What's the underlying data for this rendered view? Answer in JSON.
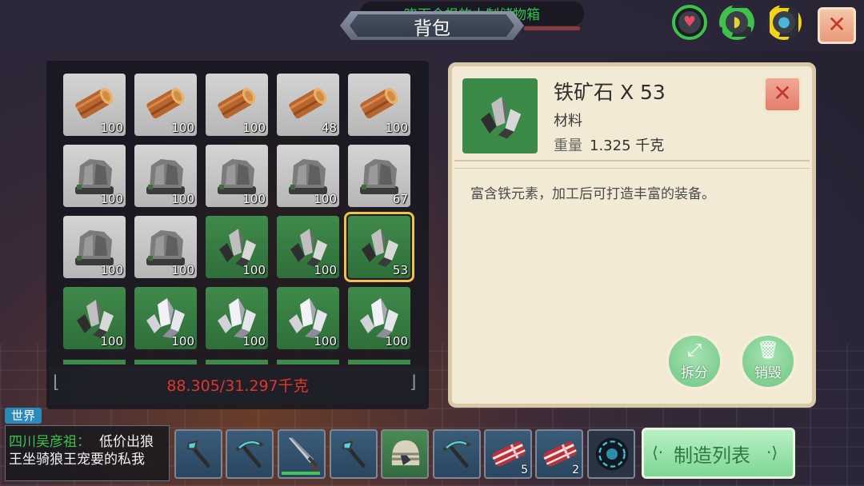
{
  "header": {
    "title": "背包",
    "banner_text": "晓下令根的木制储物箱",
    "close_label": "✕"
  },
  "status_icons": [
    {
      "name": "health-heart-icon",
      "glyph": "♥",
      "ring_color": "#3ec24c",
      "fill_fraction": 1.0
    },
    {
      "name": "hunger-banana-icon",
      "glyph": "◗",
      "ring_color": "#3ec24c",
      "fill_fraction": 0.75
    },
    {
      "name": "thirst-water-drop-icon",
      "glyph": "●",
      "ring_color": "#f2d31c",
      "fill_fraction": 0.5
    }
  ],
  "inventory": {
    "slots": [
      {
        "item": "log",
        "count": "100",
        "bg": "grey"
      },
      {
        "item": "log",
        "count": "100",
        "bg": "grey"
      },
      {
        "item": "log",
        "count": "100",
        "bg": "grey"
      },
      {
        "item": "log",
        "count": "48",
        "bg": "grey"
      },
      {
        "item": "log",
        "count": "100",
        "bg": "grey"
      },
      {
        "item": "stone",
        "count": "100",
        "bg": "grey"
      },
      {
        "item": "stone",
        "count": "100",
        "bg": "grey"
      },
      {
        "item": "stone",
        "count": "100",
        "bg": "grey"
      },
      {
        "item": "stone",
        "count": "100",
        "bg": "grey"
      },
      {
        "item": "stone",
        "count": "67",
        "bg": "grey"
      },
      {
        "item": "stone",
        "count": "100",
        "bg": "grey"
      },
      {
        "item": "stone",
        "count": "100",
        "bg": "grey"
      },
      {
        "item": "iron-ore",
        "count": "100",
        "bg": "green"
      },
      {
        "item": "iron-ore",
        "count": "100",
        "bg": "green"
      },
      {
        "item": "iron-ore",
        "count": "53",
        "bg": "green",
        "selected": true
      },
      {
        "item": "iron-ore",
        "count": "100",
        "bg": "green"
      },
      {
        "item": "silver-ore",
        "count": "100",
        "bg": "green"
      },
      {
        "item": "silver-ore",
        "count": "100",
        "bg": "green"
      },
      {
        "item": "silver-ore",
        "count": "100",
        "bg": "green"
      },
      {
        "item": "silver-ore",
        "count": "100",
        "bg": "green"
      }
    ],
    "weight": "88.305/31.297千克"
  },
  "detail": {
    "name": "铁矿石 X 53",
    "type": "材料",
    "weight_label": "重量",
    "weight_value": "1.325 千克",
    "description": "富含铁元素，加工后可打造丰富的装备。",
    "split_label": "拆分",
    "destroy_label": "销毁",
    "close_label": "✕"
  },
  "chat": {
    "channel": "世界",
    "sender": "四川吴彦祖：",
    "message_line1": "低价出狼",
    "message_line2": "王坐骑狼王宠要的私我"
  },
  "hotbar": [
    {
      "item": "axe",
      "bg": "blue",
      "count": ""
    },
    {
      "item": "pickaxe",
      "bg": "blue",
      "count": ""
    },
    {
      "item": "sword",
      "bg": "blue",
      "count": ""
    },
    {
      "item": "axe",
      "bg": "blue",
      "count": ""
    },
    {
      "item": "helmet",
      "bg": "green",
      "count": ""
    },
    {
      "item": "pickaxe",
      "bg": "blue",
      "count": ""
    },
    {
      "item": "raw-meat",
      "bg": "blue",
      "count": "5"
    },
    {
      "item": "raw-meat",
      "bg": "blue",
      "count": "2"
    },
    {
      "item": "dark-orb",
      "bg": "dark",
      "count": ""
    }
  ],
  "craft": {
    "label": "制造列表"
  },
  "colors": {
    "weight_red": "#e0362d",
    "accent_green": "#3ec24c",
    "select_gold": "#f2c14a"
  }
}
